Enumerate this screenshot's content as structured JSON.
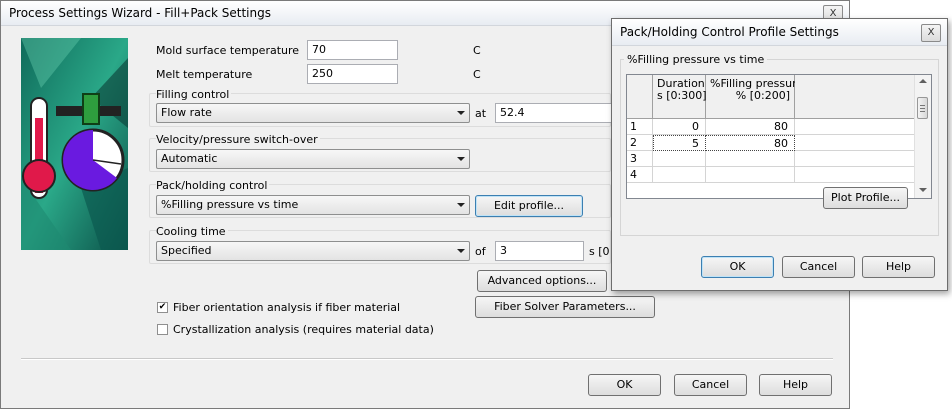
{
  "main_window": {
    "title": "Process Settings Wizard - Fill+Pack Settings",
    "close_label": "X",
    "mold_temp": {
      "label": "Mold surface temperature",
      "value": "70",
      "unit": "C"
    },
    "melt_temp": {
      "label": "Melt temperature",
      "value": "250",
      "unit": "C"
    },
    "filling_control": {
      "label": "Filling control",
      "selected": "Flow rate",
      "at_label": "at",
      "at_value": "52.4"
    },
    "switchover": {
      "label": "Velocity/pressure switch-over",
      "selected": "Automatic"
    },
    "pack_holding": {
      "label": "Pack/holding control",
      "selected": "%Filling pressure vs time",
      "edit_button": "Edit profile..."
    },
    "cooling": {
      "label": "Cooling time",
      "selected": "Specified",
      "of_label": "of",
      "value": "3",
      "unit": "s [0"
    },
    "advanced_button": "Advanced options...",
    "fiber_solver_button": "Fiber Solver Parameters...",
    "fiber_check": {
      "label": "Fiber orientation analysis if fiber material",
      "checked": true
    },
    "cryst_check": {
      "label": "Crystallization analysis (requires material data)",
      "checked": false
    },
    "ok": "OK",
    "cancel": "Cancel",
    "help": "Help"
  },
  "profile_window": {
    "title": "Pack/Holding Control Profile Settings",
    "close_label": "X",
    "group_label": "%Filling pressure vs time",
    "columns": [
      {
        "line1": "Duration",
        "line2": "s [0:300]"
      },
      {
        "line1": "%Filling pressure",
        "line2": "% [0:200]"
      }
    ],
    "rows": [
      {
        "index": "1",
        "duration": "0",
        "pressure": "80"
      },
      {
        "index": "2",
        "duration": "5",
        "pressure": "80"
      },
      {
        "index": "3",
        "duration": "",
        "pressure": ""
      },
      {
        "index": "4",
        "duration": "",
        "pressure": ""
      }
    ],
    "plot_button": "Plot Profile...",
    "ok": "OK",
    "cancel": "Cancel",
    "help": "Help"
  }
}
